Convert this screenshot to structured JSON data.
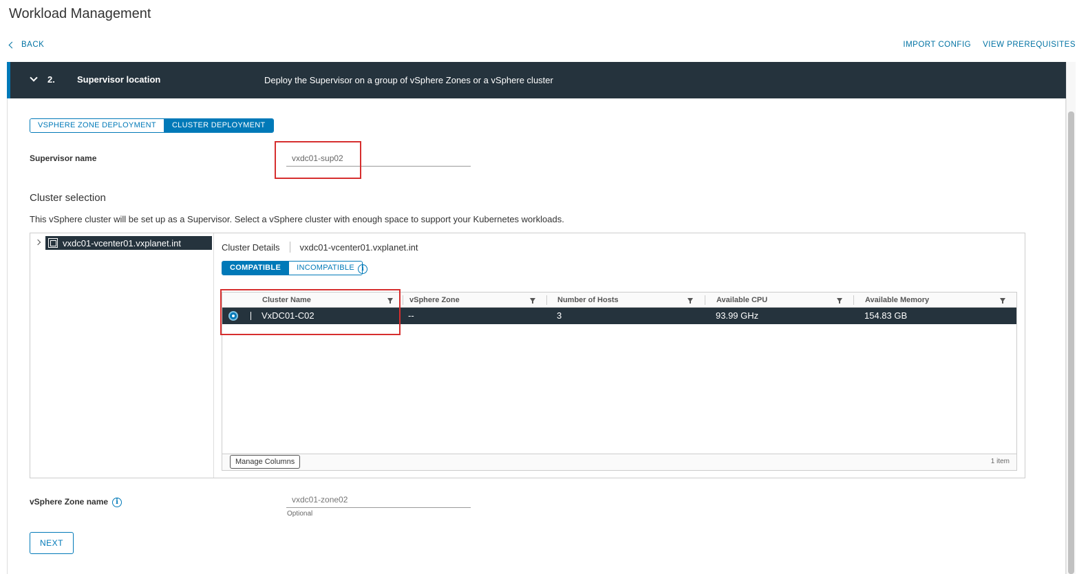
{
  "page": {
    "title": "Workload Management",
    "back_label": "BACK",
    "actions": [
      "IMPORT CONFIG",
      "VIEW PREREQUISITES"
    ]
  },
  "step": {
    "number": "2.",
    "title": "Supervisor location",
    "description": "Deploy the Supervisor on a group of vSphere Zones or a vSphere cluster"
  },
  "deployment_tabs": {
    "options": [
      "VSPHERE ZONE DEPLOYMENT",
      "CLUSTER DEPLOYMENT"
    ],
    "selected": "CLUSTER DEPLOYMENT"
  },
  "supervisor_name": {
    "label": "Supervisor name",
    "value": "vxdc01-sup02"
  },
  "cluster_selection": {
    "title": "Cluster selection",
    "description": "This vSphere cluster will be set up as a Supervisor. Select a vSphere cluster with enough space to support your Kubernetes workloads.",
    "tree_node": "vxdc01-vcenter01.vxplanet.int",
    "details_label": "Cluster Details",
    "details_value": "vxdc01-vcenter01.vxplanet.int",
    "compat_tabs": [
      "COMPATIBLE",
      "INCOMPATIBLE"
    ],
    "compat_selected": "COMPATIBLE",
    "info_icon": "i",
    "columns": [
      "Cluster Name",
      "vSphere Zone",
      "Number of Hosts",
      "Available CPU",
      "Available Memory"
    ],
    "rows": [
      {
        "cluster_name": "VxDC01-C02",
        "zone": "--",
        "hosts": "3",
        "cpu": "93.99 GHz",
        "memory": "154.83 GB",
        "selected": true
      }
    ],
    "manage_columns_label": "Manage Columns",
    "item_count": "1 item"
  },
  "zone_name": {
    "label": "vSphere Zone name",
    "info_icon": "i",
    "placeholder": "vxdc01-zone02",
    "hint": "Optional"
  },
  "next_label": "NEXT",
  "colors": {
    "accent": "#0079b8",
    "header_bg": "#25333d",
    "highlight": "#d62e2e"
  }
}
